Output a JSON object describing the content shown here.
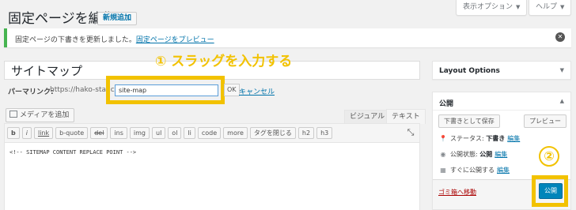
{
  "header": {
    "title": "固定ページを編集",
    "add_new": "新規追加",
    "screen_options": "表示オプション",
    "help": "ヘルプ"
  },
  "notice": {
    "text": "固定ページの下書きを更新しました。",
    "link": "固定ページをプレビュー"
  },
  "editor": {
    "title_value": "サイトマップ",
    "annotation_1": "① スラッグを入力する",
    "permalink_label": "パーマリンク:",
    "permalink_url": "https://hako-star.com/",
    "slug_value": "site-map",
    "ok_label": "OK",
    "cancel_label": "キャンセル",
    "add_media": "メディアを追加",
    "tab_visual": "ビジュアル",
    "tab_text": "テキスト",
    "quicktags": [
      "b",
      "i",
      "link",
      "b-quote",
      "del",
      "ins",
      "img",
      "ul",
      "ol",
      "li",
      "code",
      "more",
      "タグを閉じる",
      "h2",
      "h3"
    ],
    "content": "<!-- SITEMAP CONTENT REPLACE POINT -->"
  },
  "sidebar": {
    "layout_options_title": "Layout Options",
    "publish": {
      "title": "公開",
      "save_draft": "下書きとして保存",
      "preview": "プレビュー",
      "status_label": "ステータス:",
      "status_value": "下書き",
      "visibility_label": "公開状態:",
      "visibility_value": "公開",
      "schedule_label": "すぐに公開する",
      "edit_label": "編集",
      "trash": "ゴミ箱へ移動",
      "publish_button": "公開",
      "annotation_2": "②"
    }
  },
  "colors": {
    "accent": "#0073aa",
    "primary_button": "#0085ba",
    "highlight": "#f2c200",
    "notice_border": "#46b450"
  }
}
